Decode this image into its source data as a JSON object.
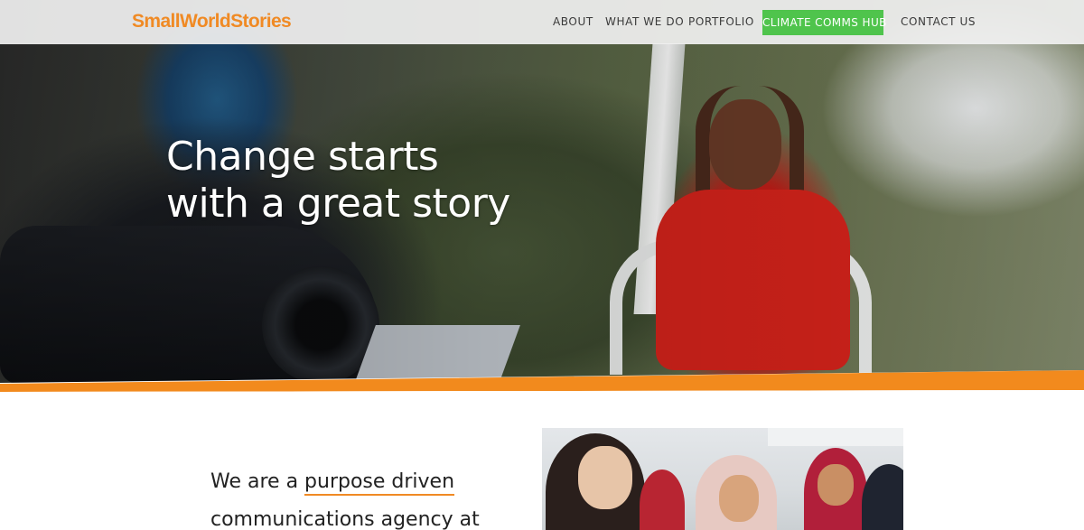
{
  "brand": {
    "logo_text": "SmallWorldStories",
    "accent_color": "#f08a24",
    "cta_color": "#4fc44c"
  },
  "nav": {
    "items": [
      {
        "label": "ABOUT"
      },
      {
        "label": "WHAT WE DO"
      },
      {
        "label": "PORTFOLIO"
      },
      {
        "label": "CLIMATE COMMS HUB"
      },
      {
        "label": "CONTACT US"
      }
    ]
  },
  "hero": {
    "heading_line1": "Change starts",
    "heading_line2": "with a great story"
  },
  "intro": {
    "prefix": "We are a ",
    "link_text_line1": "purpose driven",
    "link_text_line2": "communications agency",
    "suffix": " at"
  }
}
